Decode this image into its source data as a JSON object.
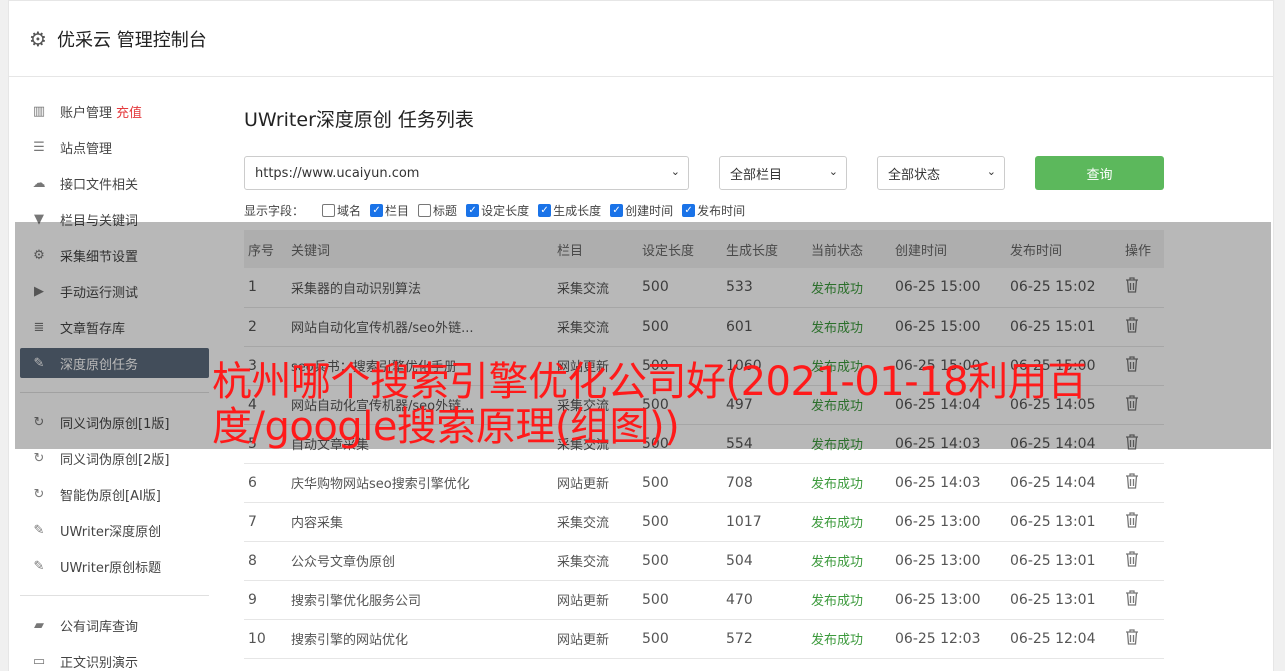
{
  "header": {
    "icon": "gear-icon",
    "title": "优采云 管理控制台"
  },
  "sidebar": {
    "items": [
      {
        "icon": "bar-chart-icon",
        "glyph": "▥",
        "label": "账户管理",
        "extra": "充值"
      },
      {
        "icon": "server-icon",
        "glyph": "☰",
        "label": "站点管理"
      },
      {
        "icon": "cloud-upload-icon",
        "glyph": "☁",
        "label": "接口文件相关"
      },
      {
        "icon": "filter-icon",
        "glyph": "▼",
        "label": "栏目与关键词"
      },
      {
        "icon": "cogs-icon",
        "glyph": "⚙",
        "label": "采集细节设置"
      },
      {
        "icon": "play-circle-icon",
        "glyph": "▶",
        "label": "手动运行测试"
      },
      {
        "icon": "database-icon",
        "glyph": "≣",
        "label": "文章暂存库"
      },
      {
        "icon": "edit-icon",
        "glyph": "✎",
        "label": "深度原创任务",
        "active": true
      },
      {
        "icon": "refresh-icon",
        "glyph": "↻",
        "label": "同义词伪原创[1版]"
      },
      {
        "icon": "refresh-icon",
        "glyph": "↻",
        "label": "同义词伪原创[2版]"
      },
      {
        "icon": "refresh-icon",
        "glyph": "↻",
        "label": "智能伪原创[AI版]"
      },
      {
        "icon": "edit-icon",
        "glyph": "✎",
        "label": "UWriter深度原创"
      },
      {
        "icon": "edit-icon",
        "glyph": "✎",
        "label": "UWriter原创标题"
      },
      {
        "icon": "book-icon",
        "glyph": "▰",
        "label": "公有词库查询"
      },
      {
        "icon": "monitor-icon",
        "glyph": "▭",
        "label": "正文识别演示"
      }
    ]
  },
  "main": {
    "heading": "UWriter深度原创 任务列表",
    "site_select": "https://www.ucaiyun.com",
    "column_select": "全部栏目",
    "status_select": "全部状态",
    "query_label": "查询",
    "fields_label": "显示字段：",
    "fields": [
      {
        "label": "域名",
        "checked": false
      },
      {
        "label": "栏目",
        "checked": true
      },
      {
        "label": "标题",
        "checked": false
      },
      {
        "label": "设定长度",
        "checked": true
      },
      {
        "label": "生成长度",
        "checked": true
      },
      {
        "label": "创建时间",
        "checked": true
      },
      {
        "label": "发布时间",
        "checked": true
      }
    ],
    "table": {
      "headers": [
        "序号",
        "关键词",
        "栏目",
        "设定长度",
        "生成长度",
        "当前状态",
        "创建时间",
        "发布时间",
        "操作"
      ],
      "rows": [
        [
          "1",
          "采集器的自动识别算法",
          "采集交流",
          "500",
          "533",
          "发布成功",
          "06-25 15:00",
          "06-25 15:02"
        ],
        [
          "2",
          "网站自动化宣传机器/seo外链...",
          "采集交流",
          "500",
          "601",
          "发布成功",
          "06-25 15:00",
          "06-25 15:01"
        ],
        [
          "3",
          "seo兵书：搜索引擎优化手册",
          "网站更新",
          "500",
          "1060",
          "发布成功",
          "06-25 15:00",
          "06-25 15:00"
        ],
        [
          "4",
          "网站自动化宣传机器/seo外链...",
          "采集交流",
          "500",
          "497",
          "发布成功",
          "06-25 14:04",
          "06-25 14:05"
        ],
        [
          "5",
          "自动文章采集",
          "采集交流",
          "500",
          "554",
          "发布成功",
          "06-25 14:03",
          "06-25 14:04"
        ],
        [
          "6",
          "庆华购物网站seo搜索引擎优化",
          "网站更新",
          "500",
          "708",
          "发布成功",
          "06-25 14:03",
          "06-25 14:04"
        ],
        [
          "7",
          "内容采集",
          "采集交流",
          "500",
          "1017",
          "发布成功",
          "06-25 13:00",
          "06-25 13:01"
        ],
        [
          "8",
          "公众号文章伪原创",
          "采集交流",
          "500",
          "504",
          "发布成功",
          "06-25 13:00",
          "06-25 13:01"
        ],
        [
          "9",
          "搜索引擎优化服务公司",
          "网站更新",
          "500",
          "470",
          "发布成功",
          "06-25 13:00",
          "06-25 13:01"
        ],
        [
          "10",
          "搜索引擎的网站优化",
          "网站更新",
          "500",
          "572",
          "发布成功",
          "06-25 12:03",
          "06-25 12:04"
        ]
      ],
      "action_icon": "trash-icon"
    }
  },
  "overlay": {
    "text": "杭州哪个搜索引擎优化公司好(2021-01-18利用百度/google搜索原理(组图))"
  },
  "colors": {
    "status_success": "#3c9a3c",
    "query_button": "#5cb85c",
    "active_nav": "#5c6b7d",
    "recharge": "#e4393c",
    "overlay_text": "#ff1a1a"
  }
}
